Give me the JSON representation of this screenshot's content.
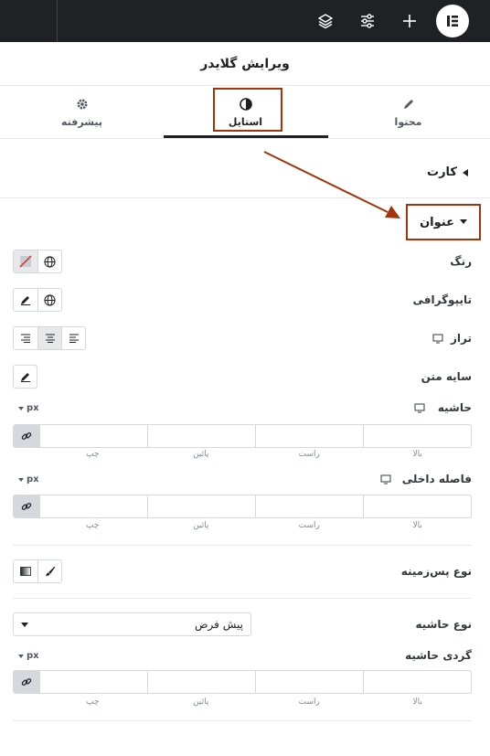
{
  "topbar": {
    "logo_icon": "elementor-logo-icon",
    "add_icon": "plus-icon",
    "settings_icon": "sliders-icon",
    "structure_icon": "layers-icon",
    "colors": {
      "background": "#1f2124"
    }
  },
  "panel": {
    "title": "ویرایش گلایدر"
  },
  "tabs": [
    {
      "label": "محتوا",
      "icon": "pencil-icon"
    },
    {
      "label": "استایل",
      "icon": "half-circle-icon",
      "active": true
    },
    {
      "label": "پیشرفته",
      "icon": "gear-icon"
    }
  ],
  "sections": {
    "card": {
      "label": "کارت"
    },
    "heading": {
      "label": "عنوان"
    }
  },
  "controls": {
    "color": {
      "label": "رنگ"
    },
    "typography": {
      "label": "تایپوگرافی"
    },
    "alignment": {
      "label": "تراز"
    },
    "text_shadow": {
      "label": "سایه متن"
    },
    "margin": {
      "label": "حاشیه",
      "unit": "px"
    },
    "padding": {
      "label": "فاصله داخلی",
      "unit": "px"
    },
    "background_type": {
      "label": "نوع پس‌زمینه"
    },
    "border_type": {
      "label": "نوع حاشیه",
      "value": "پیش فرض"
    },
    "border_radius": {
      "label": "گردی حاشیه",
      "unit": "px"
    }
  },
  "dimension_labels": {
    "top": "بالا",
    "right": "راست",
    "bottom": "پائین",
    "left": "چپ"
  },
  "annotation": {
    "color": "#a3340a"
  }
}
